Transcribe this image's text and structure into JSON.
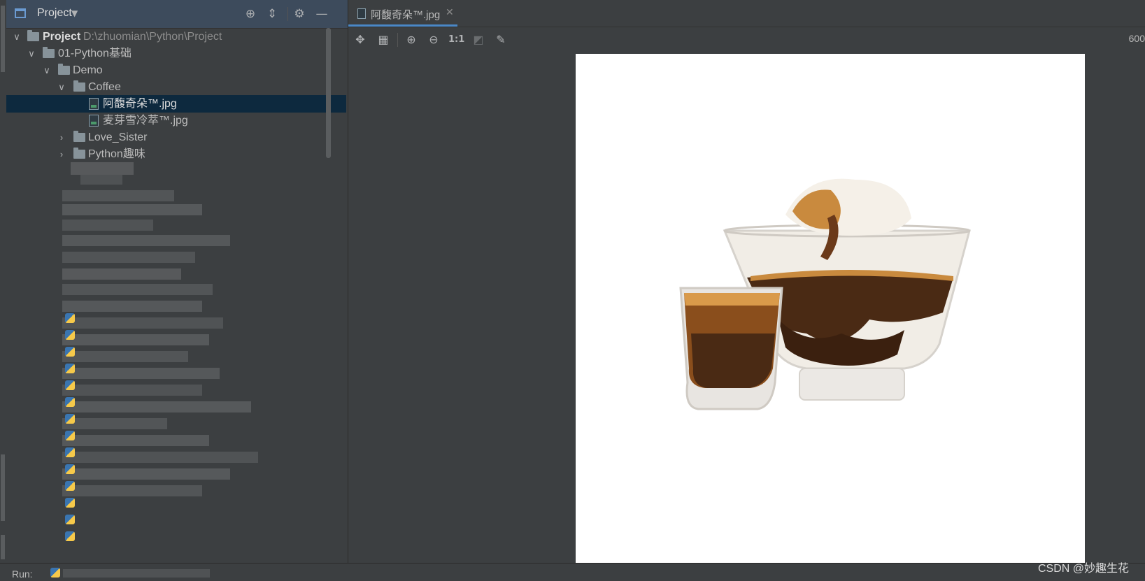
{
  "project_panel": {
    "title": "Project",
    "tree": [
      {
        "label": "Project",
        "path": "D:\\zhuomian\\Python\\Project",
        "expanded": true
      },
      {
        "label": "01-Python基础",
        "expanded": true
      },
      {
        "label": "Demo",
        "expanded": true
      },
      {
        "label": "Coffee",
        "expanded": true
      },
      {
        "label": "阿馥奇朵™.jpg",
        "selected": true
      },
      {
        "label": "麦芽雪冷萃™.jpg"
      },
      {
        "label": "Love_Sister",
        "expanded": false
      },
      {
        "label": "Python趣味",
        "expanded": false
      }
    ]
  },
  "editor": {
    "tab_label": "阿馥奇朵™.jpg",
    "zoom_readout": "600",
    "toolbar_one_to_one": "1:1",
    "image": {
      "subject": "affogato ice cream glass with espresso shot",
      "colors": {
        "background": "#ffffff",
        "espresso": "#4a2a14",
        "cream": "#f5f0e8",
        "crema": "#c98a3e"
      }
    }
  },
  "run_bar": {
    "label": "Run:"
  },
  "watermark": "CSDN @妙趣生花",
  "colors": {
    "selection": "#0d293e",
    "tab_underline": "#4a88c7",
    "panel_bg": "#3c3f41",
    "header_bg": "#3d4b5c"
  }
}
